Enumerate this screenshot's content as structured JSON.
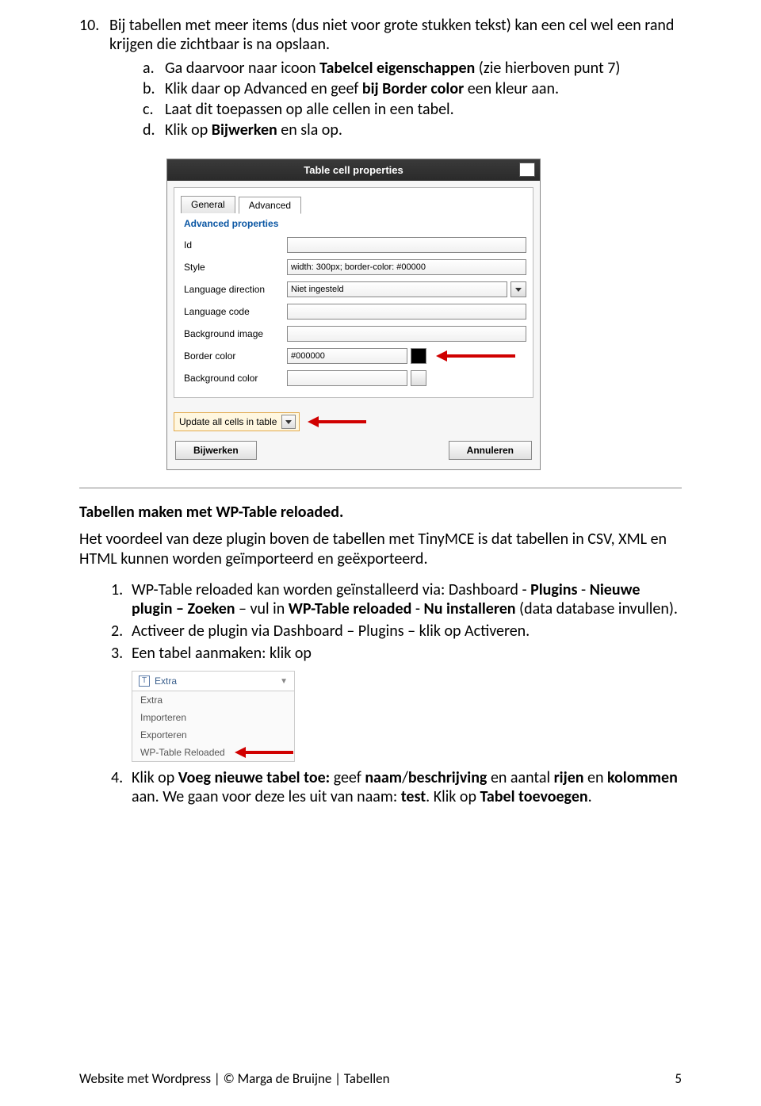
{
  "step10": {
    "num": "10.",
    "text_a": "Bij tabellen met meer items (dus niet voor grote stukken tekst) kan een cel wel een rand krijgen die zichtbaar is na opslaan.",
    "a_let": "a.",
    "a_text1": "Ga daarvoor naar icoon ",
    "a_bold": "Tabelcel eigenschappen ",
    "a_text2": " (zie hierboven punt 7)",
    "b_let": "b.",
    "b_text1": "Klik daar op Advanced en geef ",
    "b_bold": "bij Border color",
    "b_text2": " een kleur aan.",
    "c_let": "c.",
    "c_text": "Laat dit toepassen op alle cellen in een tabel.",
    "d_let": "d.",
    "d_text1": "Klik op ",
    "d_bold": "Bijwerken",
    "d_text2": " en sla op."
  },
  "dialog": {
    "title": "Table cell properties",
    "tab_general": "General",
    "tab_advanced": "Advanced",
    "section": "Advanced properties",
    "labels": {
      "id": "Id",
      "style": "Style",
      "langdir": "Language direction",
      "langcode": "Language code",
      "bgimage": "Background image",
      "bordercolor": "Border color",
      "bgcolor": "Background color"
    },
    "values": {
      "style": "width: 300px; border-color: #00000",
      "langdir": "Niet ingesteld",
      "bordercolor": "#000000"
    },
    "update_all": "Update all cells in table",
    "btn_update": "Bijwerken",
    "btn_cancel": "Annuleren"
  },
  "section2": {
    "heading": "Tabellen maken met WP-Table reloaded.",
    "intro": "Het voordeel van deze plugin boven de tabellen met TinyMCE is dat tabellen in CSV, XML en HTML kunnen worden geïmporteerd en geëxporteerd.",
    "i1n": "1.",
    "i1a": "WP-Table reloaded kan worden geïnstalleerd via: Dashboard -  ",
    "i1b": "Plugins",
    "i1c": " - ",
    "i1d": "Nieuwe plugin – Zoeken",
    "i1e": " – vul in ",
    "i1f": "WP-Table reloaded",
    "i1g": " -  ",
    "i1h": "Nu installeren",
    "i1i": " (data database invullen).",
    "i2n": "2.",
    "i2": "Activeer de plugin via Dashboard – Plugins – klik op Activeren.",
    "i3n": "3.",
    "i3": "Een tabel aanmaken: klik op",
    "menu_head": "Extra",
    "menu_items": [
      "Extra",
      "Importeren",
      "Exporteren",
      "WP-Table Reloaded"
    ],
    "i4n": "4.",
    "i4a": "Klik op ",
    "i4b": "Voeg nieuwe tabel toe:",
    "i4c": " geef ",
    "i4d": "naam",
    "i4e": "/",
    "i4f": "beschrijving",
    "i4g": " en aantal ",
    "i4h": "rijen",
    "i4i": " en ",
    "i4j": "kolommen",
    "i4k": " aan. We gaan voor deze les uit van naam: ",
    "i4l": "test",
    "i4m": ". Klik op ",
    "i4o": "Tabel toevoegen",
    "i4p": "."
  },
  "footer": {
    "left": "Website met Wordpress | © Marga de Bruijne | Tabellen",
    "page": "5"
  }
}
